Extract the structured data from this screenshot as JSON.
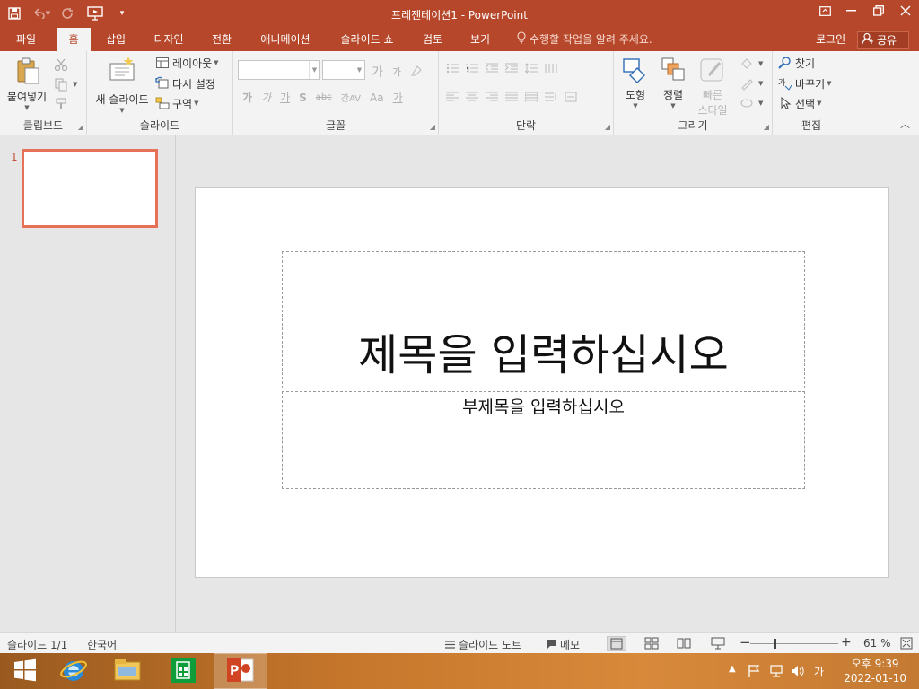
{
  "window": {
    "title": "프레젠테이션1 - PowerPoint",
    "accent": "#b7472a"
  },
  "qat": {
    "save_icon": "save-icon",
    "undo_icon": "undo-icon",
    "redo_icon": "redo-icon",
    "present_icon": "present-from-start-icon",
    "customize_icon": "customize-qat-icon"
  },
  "tabs": [
    {
      "label": "파일"
    },
    {
      "label": "홈"
    },
    {
      "label": "삽입"
    },
    {
      "label": "디자인"
    },
    {
      "label": "전환"
    },
    {
      "label": "애니메이션"
    },
    {
      "label": "슬라이드 쇼"
    },
    {
      "label": "검토"
    },
    {
      "label": "보기"
    }
  ],
  "tell_me": "수행할 작업을 알려 주세요.",
  "account": {
    "login": "로그인",
    "share": "공유"
  },
  "ribbon": {
    "clipboard": {
      "label": "클립보드",
      "paste": "붙여넣기"
    },
    "slides": {
      "label": "슬라이드",
      "new_slide": "새 슬라이드",
      "layout": "레이아웃",
      "reset": "다시 설정",
      "section": "구역"
    },
    "font": {
      "label": "글꼴",
      "font_name": "",
      "font_size": "",
      "grow": "가",
      "shrink": "가",
      "bold": "가",
      "italic": "가",
      "underline": "가",
      "shadow": "S",
      "strike": "abc",
      "spacing": "간AV",
      "case": "Aa",
      "color": "가"
    },
    "paragraph": {
      "label": "단락"
    },
    "drawing": {
      "label": "그리기",
      "shapes": "도형",
      "arrange": "정렬",
      "quick_styles_1": "빠른",
      "quick_styles_2": "스타일"
    },
    "editing": {
      "label": "편집",
      "find": "찾기",
      "replace": "바꾸기",
      "select": "선택"
    }
  },
  "thumbnails": [
    {
      "number": "1"
    }
  ],
  "slide": {
    "title_placeholder": "제목을 입력하십시오",
    "subtitle_placeholder": "부제목을 입력하십시오"
  },
  "status": {
    "slide_count": "슬라이드 1/1",
    "language": "한국어",
    "notes": "슬라이드 노트",
    "comments": "메모",
    "zoom_minus": "−",
    "zoom_plus": "+",
    "zoom": "61 %",
    "zoom_fraction": 0.28
  },
  "taskbar": {
    "time": "오후 9:39",
    "date": "2022-01-10",
    "ime": "가"
  }
}
